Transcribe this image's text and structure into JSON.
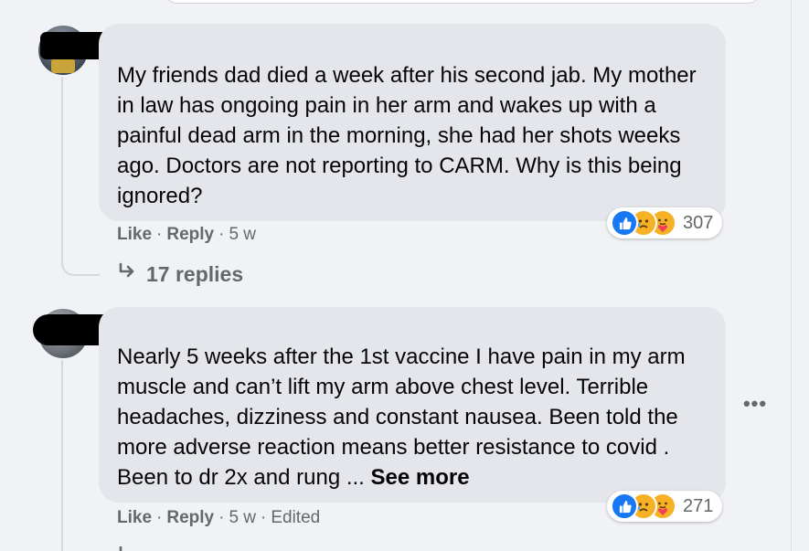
{
  "comments": [
    {
      "text": "My friends dad died a week after his second jab. My mother in law has ongoing pain in her arm and wakes up with a painful dead arm in the morning, she had her shots weeks ago. Doctors are not reporting to CARM. Why is this being ignored?",
      "like_label": "Like",
      "reply_label": "Reply",
      "time": "5 w",
      "reaction_count": "307",
      "reactions": [
        "like-icon",
        "sad-icon",
        "care-icon"
      ],
      "replies_label": "17 replies"
    },
    {
      "text": "Nearly 5 weeks after the 1st vaccine I have pain in my arm muscle and can’t lift my arm above chest level. Terrible headaches, dizziness and constant nausea. Been told the more adverse reaction means better resistance to covid . Been to dr 2x and rung ...",
      "see_more": "See more",
      "like_label": "Like",
      "reply_label": "Reply",
      "time": "5 w",
      "edited": "Edited",
      "reaction_count": "271",
      "reactions": [
        "like-icon",
        "sad-icon",
        "care-icon"
      ]
    }
  ],
  "colors": {
    "bubble": "#e4e6eb",
    "secondary_text": "#65676b",
    "like_blue": "#1877f2",
    "emoji_yellow": "#f7b125"
  }
}
